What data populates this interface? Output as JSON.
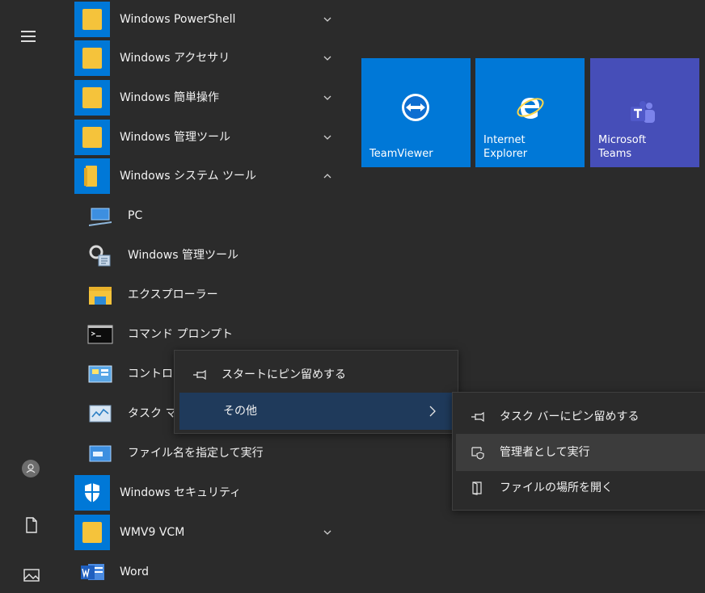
{
  "apps": {
    "powershell": "Windows PowerShell",
    "accessories": "Windows アクセサリ",
    "ease_of_access": "Windows 簡単操作",
    "admin_tools": "Windows 管理ツール",
    "system_tools": "Windows システム ツール",
    "pc": "PC",
    "admin_tools_sub": "Windows 管理ツール",
    "explorer": "エクスプローラー",
    "command_prompt": "コマンド プロンプト",
    "control_panel": "コントロー",
    "task_manager": "タスク マ",
    "run": "ファイル名を指定して実行",
    "security": "Windows セキュリティ",
    "wmv9": "WMV9 VCM",
    "word": "Word"
  },
  "tiles": {
    "teamviewer": "TeamViewer",
    "ie": "Internet\nExplorer",
    "teams": "Microsoft\nTeams"
  },
  "context_menu": {
    "pin_start": "スタートにピン留めする",
    "more": "その他"
  },
  "submenu": {
    "pin_taskbar": "タスク バーにピン留めする",
    "run_as_admin": "管理者として実行",
    "open_location": "ファイルの場所を開く"
  },
  "colors": {
    "accent": "#0078d7",
    "teams_tile": "#464eb8",
    "folder": "#f5c33b",
    "menu_bg": "#2b2b2b"
  }
}
